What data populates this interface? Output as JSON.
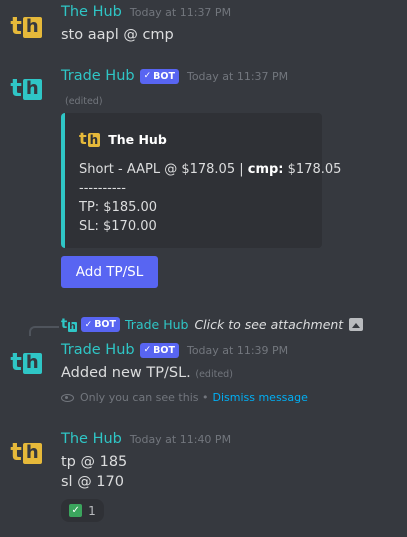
{
  "messages": [
    {
      "username": "The Hub",
      "timestamp": "Today at 11:37 PM",
      "content": "sto aapl @ cmp"
    },
    {
      "username": "Trade Hub",
      "bot_label": "BOT",
      "timestamp": "Today at 11:37 PM",
      "edited": "(edited)",
      "embed": {
        "author": "The Hub",
        "line1_prefix": "Short - AAPL @ $178.05 | ",
        "line1_bold": "cmp:",
        "line1_suffix": " $178.05",
        "line2": "----------",
        "line3": "TP: $185.00",
        "line4": "SL: $170.00",
        "accent": "#2fc6c6"
      },
      "button_label": "Add TP/SL"
    },
    {
      "reply": {
        "bot_label": "BOT",
        "username": "Trade Hub",
        "text": "Click to see attachment"
      },
      "username": "Trade Hub",
      "bot_label": "BOT",
      "timestamp": "Today at 11:39 PM",
      "content": "Added new TP/SL.",
      "edited": "(edited)",
      "ephemeral_text": "Only you can see this •",
      "dismiss_label": "Dismiss message"
    },
    {
      "username": "The Hub",
      "timestamp": "Today at 11:40 PM",
      "content_line1": "tp @ 185",
      "content_line2": "sl @ 170",
      "reaction_count": "1"
    }
  ],
  "colors": {
    "background": "#36393f",
    "blurple": "#5865f2",
    "teal": "#2fc6c6",
    "gold": "#e6b93a",
    "link": "#00aff4"
  },
  "icons": [
    "the-hub-logo-icon",
    "trade-hub-logo-icon",
    "verified-check-icon",
    "image-icon",
    "eye-icon",
    "checkbox-emoji-icon"
  ]
}
